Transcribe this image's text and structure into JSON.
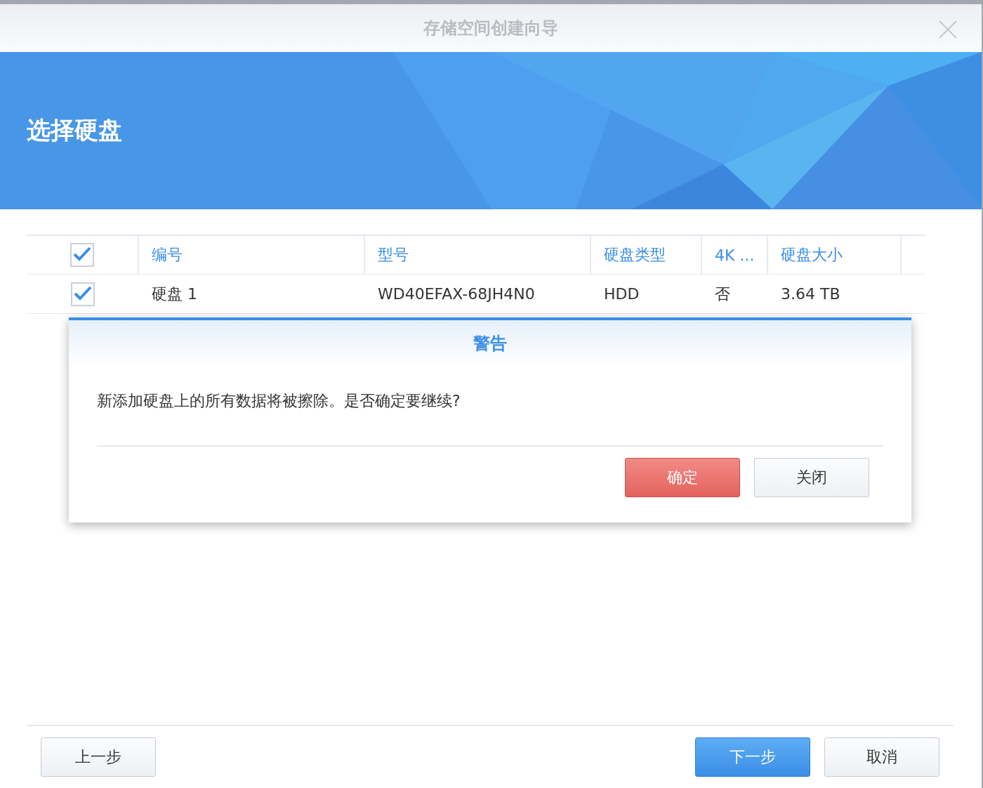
{
  "window": {
    "title": "存储空间创建向导"
  },
  "banner": {
    "title": "选择硬盘"
  },
  "table": {
    "select_all_checked": true,
    "columns": [
      "编号",
      "型号",
      "硬盘类型",
      "4K ...",
      "硬盘大小"
    ],
    "rows": [
      {
        "checked": true,
        "cells": [
          "硬盘 1",
          "WD40EFAX-68JH4N0",
          "HDD",
          "否",
          "3.64 TB"
        ]
      }
    ]
  },
  "dialog": {
    "title": "警告",
    "message": "新添加硬盘上的所有数据将被擦除。是否确定要继续?",
    "buttons": [
      {
        "label": "确定",
        "kind": "danger"
      },
      {
        "label": "关闭",
        "kind": "normal"
      }
    ]
  },
  "footer": {
    "left": [
      {
        "label": "上一步",
        "kind": "normal"
      }
    ],
    "right": [
      {
        "label": "下一步",
        "kind": "primary"
      },
      {
        "label": "取消",
        "kind": "normal"
      }
    ]
  }
}
